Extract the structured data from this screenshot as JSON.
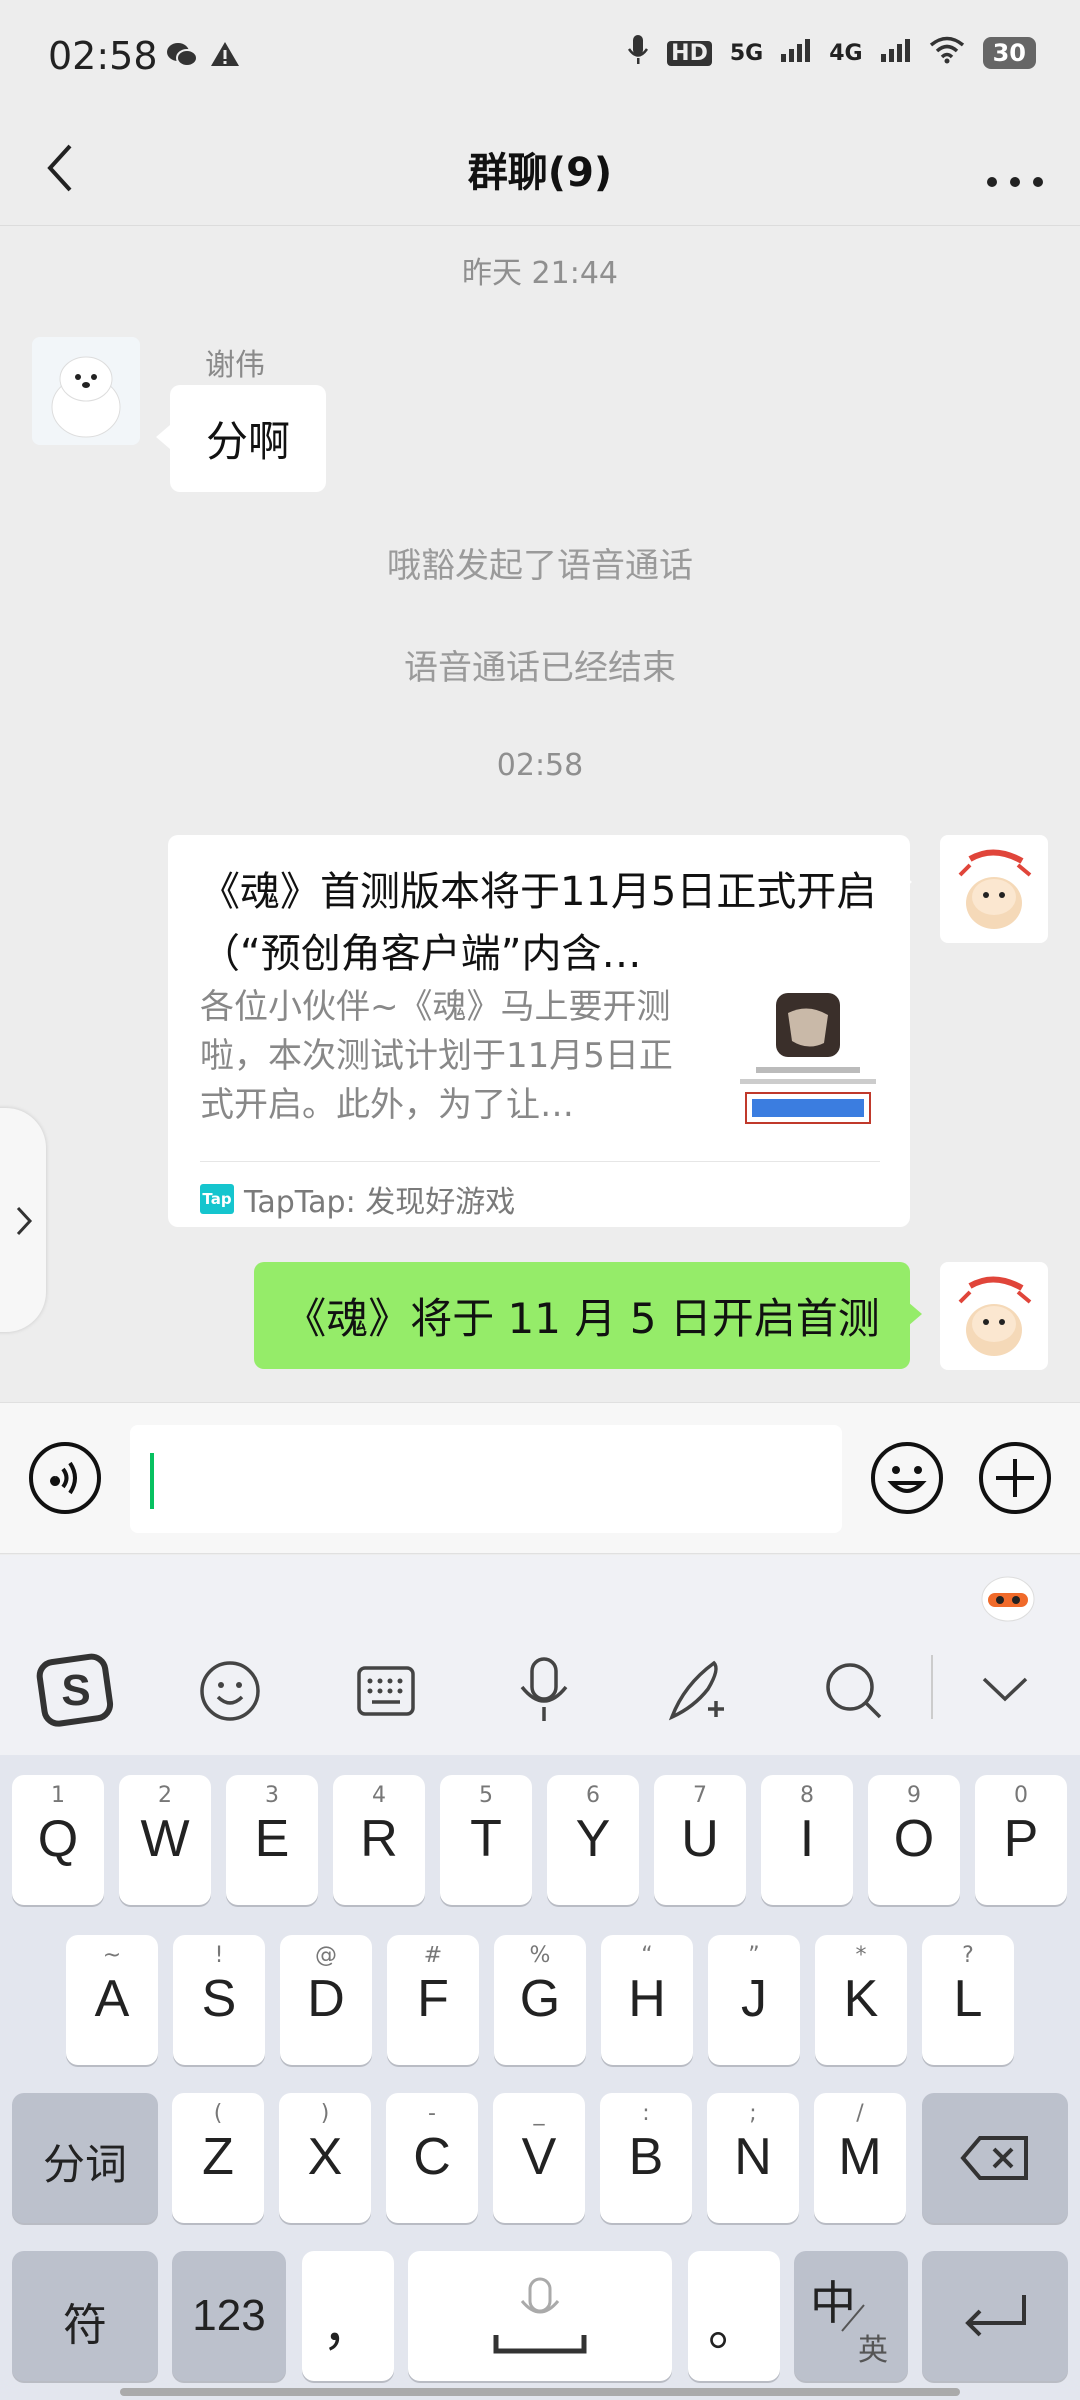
{
  "status_bar": {
    "time": "02:58",
    "battery": "30",
    "network1": "5G",
    "network2": "4G",
    "hd": "HD"
  },
  "nav": {
    "title": "群聊(9)"
  },
  "chat": {
    "time_yesterday": "昨天 21:44",
    "msg1_sender": "谢伟",
    "msg1_text": "分啊",
    "sys_call_start": "哦豁发起了语音通话",
    "sys_call_end": "语音通话已经结束",
    "time_now": "02:58",
    "card": {
      "title": "《魂》首测版本将于11月5日正式开启（“预创角客户端”内含…",
      "desc": "各位小伙伴~《魂》马上要开测啦，本次测试计划于11月5日正式开启。此外，为了让…",
      "source": "TapTap: 发现好游戏",
      "source_logo": "Tap"
    },
    "msg3_text": "《魂》将于 11 月 5 日开启首测"
  },
  "keyboard": {
    "row1": [
      [
        "Q",
        "1"
      ],
      [
        "W",
        "2"
      ],
      [
        "E",
        "3"
      ],
      [
        "R",
        "4"
      ],
      [
        "T",
        "5"
      ],
      [
        "Y",
        "6"
      ],
      [
        "U",
        "7"
      ],
      [
        "I",
        "8"
      ],
      [
        "O",
        "9"
      ],
      [
        "P",
        "0"
      ]
    ],
    "row2": [
      [
        "A",
        "~"
      ],
      [
        "S",
        "!"
      ],
      [
        "D",
        "@"
      ],
      [
        "F",
        "#"
      ],
      [
        "G",
        "%"
      ],
      [
        "H",
        "“"
      ],
      [
        "J",
        "”"
      ],
      [
        "K",
        "*"
      ],
      [
        "L",
        "?"
      ]
    ],
    "row3": [
      [
        "Z",
        "("
      ],
      [
        "X",
        ")"
      ],
      [
        "C",
        "-"
      ],
      [
        "V",
        "_"
      ],
      [
        "B",
        ":"
      ],
      [
        "N",
        ";"
      ],
      [
        "M",
        "/"
      ]
    ],
    "fenci": "分词",
    "fu": "符",
    "num": "123",
    "comma": "，",
    "period": "。",
    "zh": "中",
    "en": "英"
  },
  "colors": {
    "green_bubble": "#95ec69",
    "accent": "#07c160",
    "background": "#ededed"
  }
}
